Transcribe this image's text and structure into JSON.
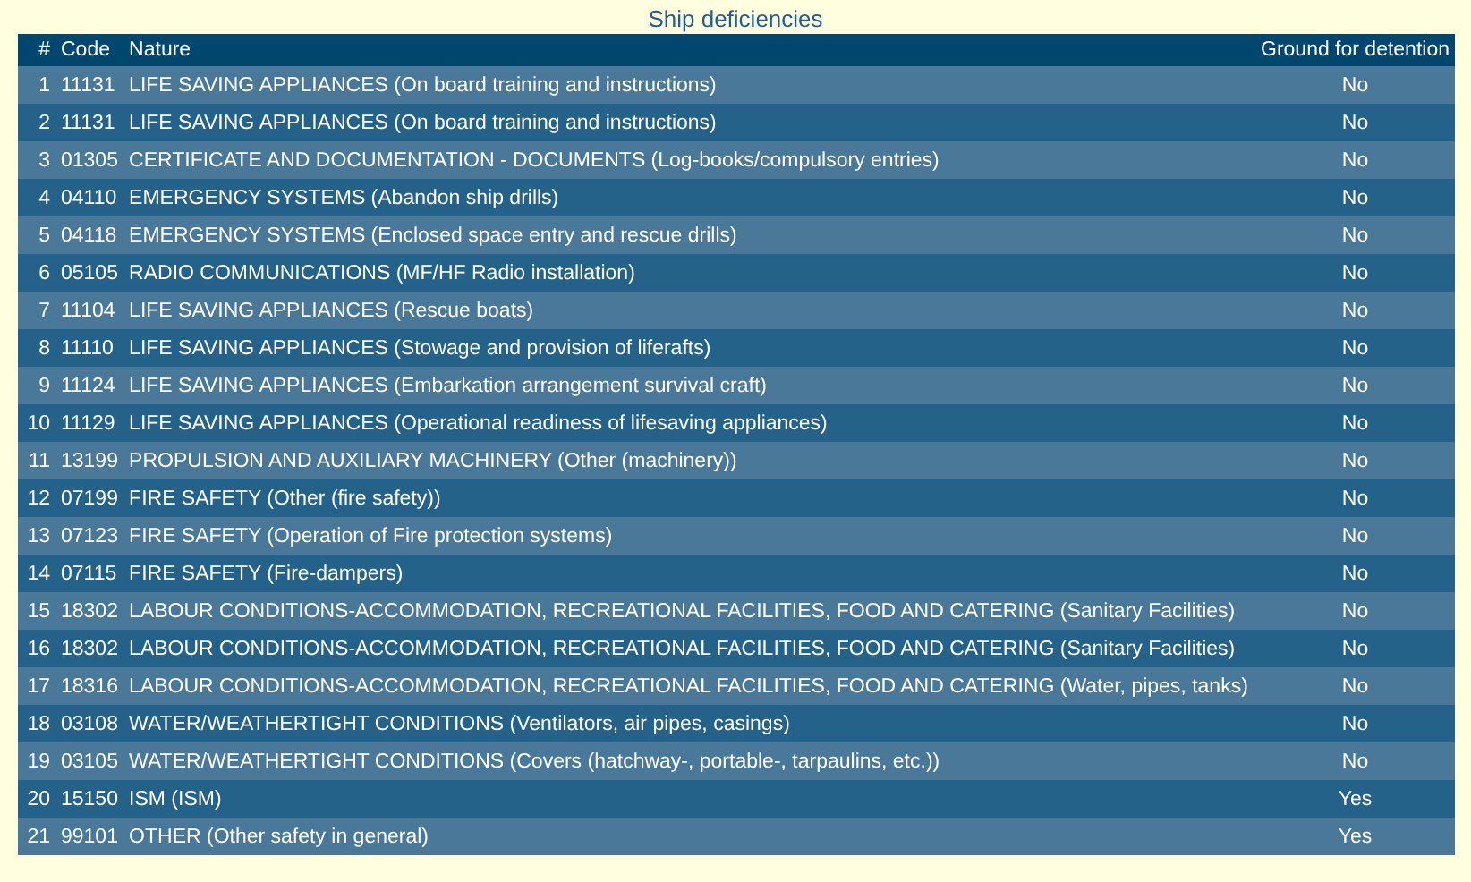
{
  "title": "Ship deficiencies",
  "columns": [
    "#",
    "Code",
    "Nature",
    "Ground for detention"
  ],
  "rows": [
    {
      "num": "1",
      "code": "11131",
      "nature": "LIFE SAVING APPLIANCES (On board training and instructions)",
      "detention": "No"
    },
    {
      "num": "2",
      "code": "11131",
      "nature": "LIFE SAVING APPLIANCES (On board training and instructions)",
      "detention": "No"
    },
    {
      "num": "3",
      "code": "01305",
      "nature": "CERTIFICATE AND DOCUMENTATION - DOCUMENTS (Log-books/compulsory entries)",
      "detention": "No"
    },
    {
      "num": "4",
      "code": "04110",
      "nature": "EMERGENCY SYSTEMS (Abandon ship drills)",
      "detention": "No"
    },
    {
      "num": "5",
      "code": "04118",
      "nature": "EMERGENCY SYSTEMS (Enclosed space entry and rescue drills)",
      "detention": "No"
    },
    {
      "num": "6",
      "code": "05105",
      "nature": "RADIO COMMUNICATIONS (MF/HF Radio installation)",
      "detention": "No"
    },
    {
      "num": "7",
      "code": "11104",
      "nature": "LIFE SAVING APPLIANCES (Rescue boats)",
      "detention": "No"
    },
    {
      "num": "8",
      "code": "11110",
      "nature": "LIFE SAVING APPLIANCES (Stowage and provision of liferafts)",
      "detention": "No"
    },
    {
      "num": "9",
      "code": "11124",
      "nature": "LIFE SAVING APPLIANCES (Embarkation arrangement survival craft)",
      "detention": "No"
    },
    {
      "num": "10",
      "code": "11129",
      "nature": "LIFE SAVING APPLIANCES (Operational readiness of lifesaving appliances)",
      "detention": "No"
    },
    {
      "num": "11",
      "code": "13199",
      "nature": "PROPULSION AND AUXILIARY MACHINERY (Other (machinery))",
      "detention": "No"
    },
    {
      "num": "12",
      "code": "07199",
      "nature": "FIRE SAFETY (Other (fire safety))",
      "detention": "No"
    },
    {
      "num": "13",
      "code": "07123",
      "nature": "FIRE SAFETY (Operation of Fire protection systems)",
      "detention": "No"
    },
    {
      "num": "14",
      "code": "07115",
      "nature": "FIRE SAFETY (Fire-dampers)",
      "detention": "No"
    },
    {
      "num": "15",
      "code": "18302",
      "nature": "LABOUR CONDITIONS-ACCOMMODATION, RECREATIONAL FACILITIES, FOOD AND CATERING (Sanitary Facilities)",
      "detention": "No"
    },
    {
      "num": "16",
      "code": "18302",
      "nature": "LABOUR CONDITIONS-ACCOMMODATION, RECREATIONAL FACILITIES, FOOD AND CATERING (Sanitary Facilities)",
      "detention": "No"
    },
    {
      "num": "17",
      "code": "18316",
      "nature": "LABOUR CONDITIONS-ACCOMMODATION, RECREATIONAL FACILITIES, FOOD AND CATERING (Water, pipes, tanks)",
      "detention": "No"
    },
    {
      "num": "18",
      "code": "03108",
      "nature": "WATER/WEATHERTIGHT CONDITIONS (Ventilators, air pipes, casings)",
      "detention": "No"
    },
    {
      "num": "19",
      "code": "03105",
      "nature": "WATER/WEATHERTIGHT CONDITIONS (Covers (hatchway-, portable-, tarpaulins, etc.))",
      "detention": "No"
    },
    {
      "num": "20",
      "code": "15150",
      "nature": "ISM (ISM)",
      "detention": "Yes"
    },
    {
      "num": "21",
      "code": "99101",
      "nature": "OTHER (Other safety in general)",
      "detention": "Yes"
    }
  ]
}
